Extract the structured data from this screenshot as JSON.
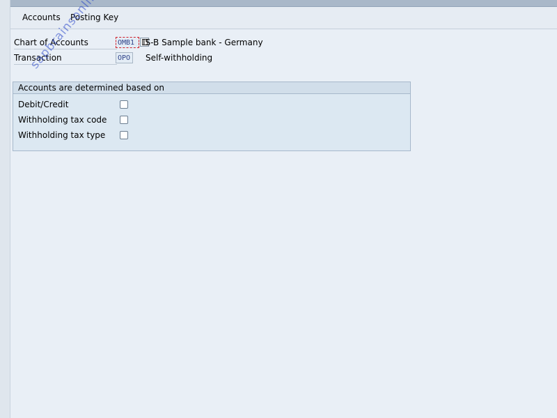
{
  "menubar": {
    "items": [
      {
        "label": "Accounts"
      },
      {
        "label": "Posting Key"
      }
    ]
  },
  "header_fields": {
    "chart_of_accounts": {
      "label": "Chart of Accounts",
      "value": "OMB1",
      "description": "IS-B Sample bank - Germany"
    },
    "transaction": {
      "label": "Transaction",
      "value": "OPO",
      "description": "Self-withholding"
    }
  },
  "group": {
    "title": "Accounts are determined based on",
    "options": [
      {
        "label": "Debit/Credit",
        "checked": false
      },
      {
        "label": "Withholding tax code",
        "checked": false
      },
      {
        "label": "Withholding tax type",
        "checked": false
      }
    ]
  },
  "watermark": "sapbrainsonline.com",
  "colors": {
    "focus_border": "#d0202a",
    "field_text": "#2a3f87",
    "background": "#e9eff6"
  }
}
